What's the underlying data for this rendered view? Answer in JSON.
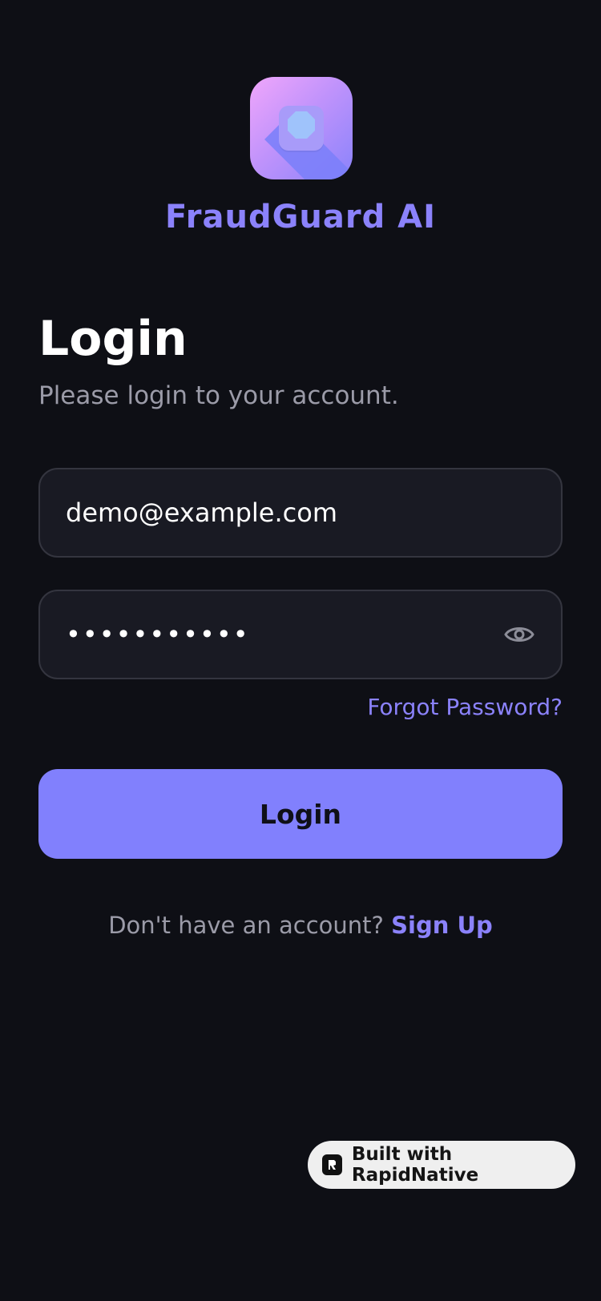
{
  "brand": {
    "name": "FraudGuard AI",
    "icon": "shield-app-icon",
    "accent": "#8b82fb"
  },
  "login": {
    "title": "Login",
    "subtitle": "Please login to your account.",
    "email_value": "demo@example.com",
    "password_value": "•••••••••••",
    "forgot_label": "Forgot Password?",
    "button_label": "Login",
    "signup_prompt": "Don't have an account?",
    "signup_label": "Sign Up"
  },
  "badge": {
    "label": "Built with RapidNative",
    "icon": "rapidnative-logo"
  },
  "colors": {
    "background": "#0e0f15",
    "field_bg": "#191a23",
    "button_bg": "#8180fd"
  }
}
